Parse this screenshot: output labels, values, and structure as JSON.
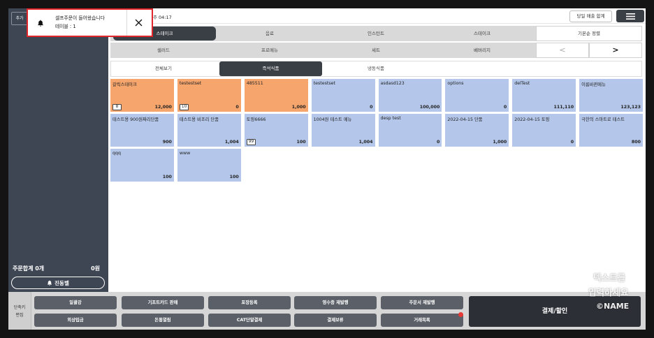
{
  "colors": {
    "frame": "#141414",
    "sidebar": "#3e4553",
    "active_tab": "#3a3e45",
    "orange": "#f6a56d",
    "blue": "#b4c7ea",
    "shortcut_button": "#5b6068",
    "pay_button": "#2c2f35",
    "alert_border": "#e0262b",
    "notification_dot": "#e53935"
  },
  "icons": {
    "notification": "bell-icon",
    "close": "close-icon",
    "menu": "hamburger-icon",
    "vibration_bell": "bell-icon"
  },
  "notification": {
    "message": "셀프주문이 들어왔습니다",
    "table": "테이블 : 1"
  },
  "sidebar": {
    "add_label": "추가",
    "order_total_label": "주문합계 0개",
    "order_total_amount": "0원",
    "vibration_bell_label": "진동벨"
  },
  "header": {
    "time": "주 04:17",
    "daily_sales_label": "당일 매출 합계"
  },
  "categories": {
    "row1": [
      {
        "label": "스테이크",
        "active": true
      },
      {
        "label": "음료",
        "active": false
      },
      {
        "label": "인스턴트",
        "active": false
      },
      {
        "label": "스테이크",
        "active": false
      }
    ],
    "row2": [
      {
        "label": "샐러드"
      },
      {
        "label": "프로메뉴"
      },
      {
        "label": "세트"
      },
      {
        "label": "베버리지"
      }
    ],
    "sort_label": "기본순 정렬",
    "prev_label": "<",
    "next_label": ">"
  },
  "subcategories": [
    {
      "label": "전체보기",
      "active": false
    },
    {
      "label": "즉석식품",
      "active": true
    },
    {
      "label": "냉동식품",
      "active": false
    }
  ],
  "menu_items": [
    {
      "name": "갈릭스테이크",
      "price": "12,000",
      "badge": "8",
      "color": "orange"
    },
    {
      "name": "testestset",
      "price": "0",
      "badge": "10",
      "color": "orange"
    },
    {
      "name": "485511",
      "price": "1,000",
      "color": "orange"
    },
    {
      "name": "testestset",
      "price": "0",
      "color": "blue"
    },
    {
      "name": "asdasd123",
      "price": "100,000",
      "color": "blue"
    },
    {
      "name": "options",
      "price": "0",
      "color": "blue"
    },
    {
      "name": "delTest",
      "price": "111,110",
      "color": "blue"
    },
    {
      "name": "이름바뀐메뉴",
      "price": "123,123",
      "color": "blue"
    },
    {
      "name": "테스트용 900원짜리단품",
      "price": "900",
      "color": "blue"
    },
    {
      "name": "테스트용 비조리 단품",
      "price": "1,004",
      "color": "blue"
    },
    {
      "name": "토핑6666",
      "price": "100",
      "badge": "99",
      "color": "blue"
    },
    {
      "name": "1004원 테스트 메뉴",
      "price": "1,004",
      "color": "blue"
    },
    {
      "name": "desp test",
      "price": "0",
      "color": "blue"
    },
    {
      "name": "2022-04-15 단품",
      "price": "1,000",
      "color": "blue"
    },
    {
      "name": "2022-04-15 토핑",
      "price": "0",
      "color": "blue"
    },
    {
      "name": "극한의 스마트로 테스트",
      "price": "800",
      "color": "blue"
    },
    {
      "name": "qqq",
      "price": "100",
      "color": "blue"
    },
    {
      "name": "www",
      "price": "100",
      "color": "blue"
    }
  ],
  "shortcuts": {
    "edit_line1": "단축키",
    "edit_line2": "편집",
    "buttons": [
      "일괄강",
      "기프트카드 판매",
      "포장등록",
      "영수증 재발행",
      "주문서 재발행",
      "외상입금",
      "돈통열림",
      "CAT단말결제",
      "결제보류",
      "거래목록"
    ]
  },
  "pay_label": "결제/할인",
  "watermark": {
    "line1": "텍스트를",
    "line2": "입력하세요",
    "line3": "©NAME"
  }
}
